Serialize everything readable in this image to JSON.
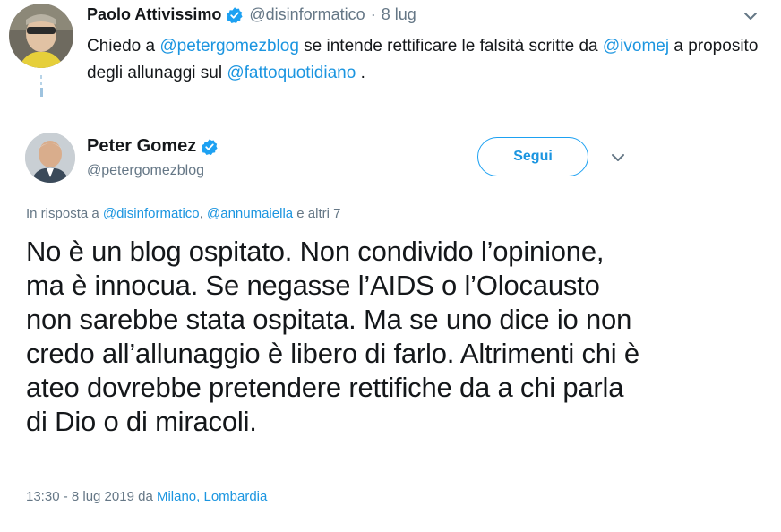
{
  "parent_tweet": {
    "author_name": "Paolo Attivissimo",
    "author_handle": "@disinformatico",
    "separator": "·",
    "date": "8 lug",
    "text_parts": [
      {
        "text": "Chiedo a ",
        "link": false
      },
      {
        "text": "@petergomezblog",
        "link": true
      },
      {
        "text": " se intende rettificare le falsità scritte da ",
        "link": false
      },
      {
        "text": "@ivomej",
        "link": true
      },
      {
        "text": " a proposito degli allunaggi sul ",
        "link": false
      },
      {
        "text": "@fattoquotidiano",
        "link": true
      },
      {
        "text": " .",
        "link": false
      }
    ]
  },
  "main_tweet": {
    "author_name": "Peter Gomez",
    "author_handle": "@petergomezblog",
    "follow_label": "Segui",
    "reply_prefix": "In risposta a ",
    "reply_handle_1": "@disinformatico",
    "reply_comma": ", ",
    "reply_handle_2": "@annumaiella",
    "reply_suffix": " e altri 7",
    "text": "No è un blog ospitato. Non condivido l’opinione, ma è innocua. Se negasse l’AIDS o l’Olocausto non sarebbe stata ospitata. Ma se uno dice io non credo all’allunaggio è libero di farlo. Altrimenti chi è ateo dovrebbe pretendere rettifiche da a chi parla di Dio o di miracoli.",
    "time": "13:30 - 8 lug 2019 da ",
    "location": "Milano, Lombardia"
  },
  "colors": {
    "link": "#1b95e0",
    "verified": "#1da1f2",
    "muted": "#657786",
    "text": "#14171a"
  }
}
